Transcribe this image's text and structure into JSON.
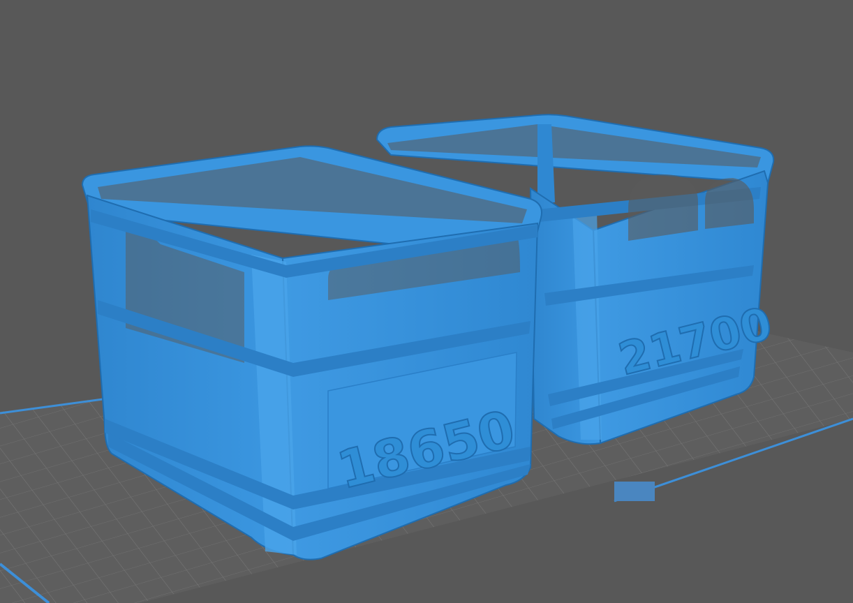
{
  "viewport": {
    "background_color": "#585858",
    "build_plate": {
      "surface_color": "#5e5e5e",
      "grid_line_color": "#767676",
      "outline_color": "#3d8fd8"
    }
  },
  "models": [
    {
      "name": "crate-18650",
      "label": "18650",
      "color": "#3a96e0",
      "shade_color": "#2a7fc8",
      "highlight_color": "#57adf0"
    },
    {
      "name": "crate-21700",
      "label": "21700",
      "color": "#3a96e0",
      "shade_color": "#2a7fc8",
      "highlight_color": "#57adf0"
    }
  ]
}
